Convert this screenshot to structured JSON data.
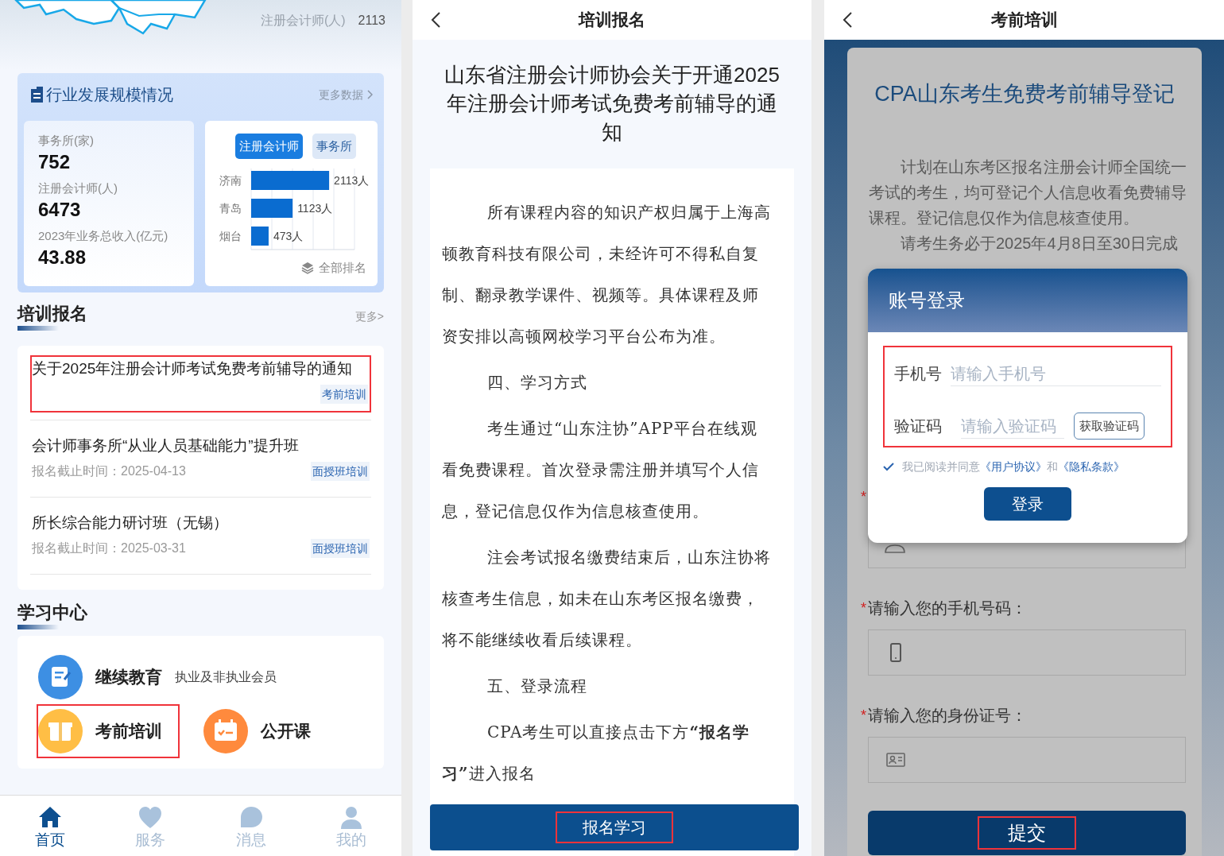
{
  "home": {
    "map_stat": {
      "label": "注册会计师(人)",
      "value": "2113"
    },
    "industry": {
      "title": "行业发展规模情况",
      "more": "更多数据",
      "stats": [
        {
          "label": "事务所(家)",
          "value": "752"
        },
        {
          "label": "注册会计师(人)",
          "value": "6473"
        },
        {
          "label": "2023年业务总收入(亿元)",
          "value": "43.88"
        }
      ],
      "tabs": [
        {
          "label": "注册会计师",
          "selected": true
        },
        {
          "label": "事务所",
          "selected": false
        }
      ],
      "chart_data": {
        "type": "bar",
        "orientation": "horizontal",
        "categories": [
          "济南",
          "青岛",
          "烟台"
        ],
        "values": [
          2113,
          1123,
          473
        ],
        "xlim": [
          0,
          2800
        ],
        "value_labels": [
          "2113人",
          "1123人",
          "473人"
        ]
      },
      "ranking_link": "全部排名"
    },
    "training": {
      "title": "培训报名",
      "more": "更多>",
      "items": [
        {
          "title": "关于2025年注册会计师考试免费考前辅导的通知",
          "tag": "考前培训",
          "highlighted": true
        },
        {
          "title": "会计师事务所“从业人员基础能力”提升班",
          "deadline": "报名截止时间：2025-04-13",
          "tag": "面授班培训",
          "highlighted": false
        },
        {
          "title": "所长综合能力研讨班（无锡）",
          "deadline": "报名截止时间：2025-03-31",
          "tag": "面授班培训",
          "highlighted": false
        }
      ]
    },
    "learning": {
      "title": "学习中心",
      "items": [
        {
          "label": "继续教育",
          "subtitle": "执业及非执业会员",
          "kind": "document",
          "highlighted": false
        },
        {
          "label": "考前培训",
          "kind": "gift",
          "highlighted": true
        },
        {
          "label": "公开课",
          "kind": "calendar",
          "highlighted": false
        }
      ]
    },
    "nav": [
      {
        "label": "首页",
        "kind": "home",
        "selected": true
      },
      {
        "label": "服务",
        "kind": "heart",
        "selected": false
      },
      {
        "label": "消息",
        "kind": "chat",
        "selected": false
      },
      {
        "label": "我的",
        "kind": "person",
        "selected": false
      }
    ]
  },
  "notice": {
    "header": "培训报名",
    "title": "山东省注册会计师协会关于开通2025年注册会计师考试免费考前辅导的通知",
    "paragraphs": [
      "所有课程内容的知识产权归属于上海高顿教育科技有限公司，未经许可不得私自复制、翻录教学课件、视频等。具体课程及师资安排以高顿网校学习平台公布为准。",
      "四、学习方式",
      "考生通过“山东注协”APP平台在线观看免费课程。首次登录需注册并填写个人信息，登记信息仅作为信息核查使用。",
      "注会考试报名缴费结束后，山东注协将核查考生信息，如未在山东考区报名缴费，将不能继续收看后续课程。",
      "五、登录流程",
      "CPA考生可以直接点击下方**“报名学习”**进入报名"
    ],
    "button": {
      "label": "报名学习",
      "highlighted": true
    }
  },
  "registration": {
    "header": "考前培训",
    "title": "CPA山东考生免费考前辅导登记",
    "paragraphs": [
      "计划在山东考区报名注册会计师全国统一考试的考生，均可登记个人信息收看免费辅导课程。登记信息仅作为信息核查使用。",
      "请考生务必于2025年4月8日至30日完成"
    ],
    "fields": [
      {
        "kind": "person",
        "marker": "*"
      },
      {
        "kind": "phone",
        "marker": "*",
        "label": "请输入您的手机号码："
      },
      {
        "kind": "id",
        "marker": "*",
        "label": "请输入您的身份证号："
      }
    ],
    "submit": {
      "label": "提交",
      "highlighted": true
    },
    "login": {
      "title": "账号登录",
      "fields_highlighted": true,
      "phone": {
        "label": "手机号",
        "placeholder": "请输入手机号"
      },
      "code": {
        "label": "验证码",
        "placeholder": "请输入验证码",
        "button": "获取验证码"
      },
      "agreement": {
        "checked": true,
        "parts": [
          {
            "kind": "text",
            "text": "我已阅读并同意"
          },
          {
            "kind": "link",
            "text": "《用户协议》"
          },
          {
            "kind": "text",
            "text": "和"
          },
          {
            "kind": "link",
            "text": "《隐私条款》"
          }
        ]
      },
      "button": "登录"
    }
  }
}
